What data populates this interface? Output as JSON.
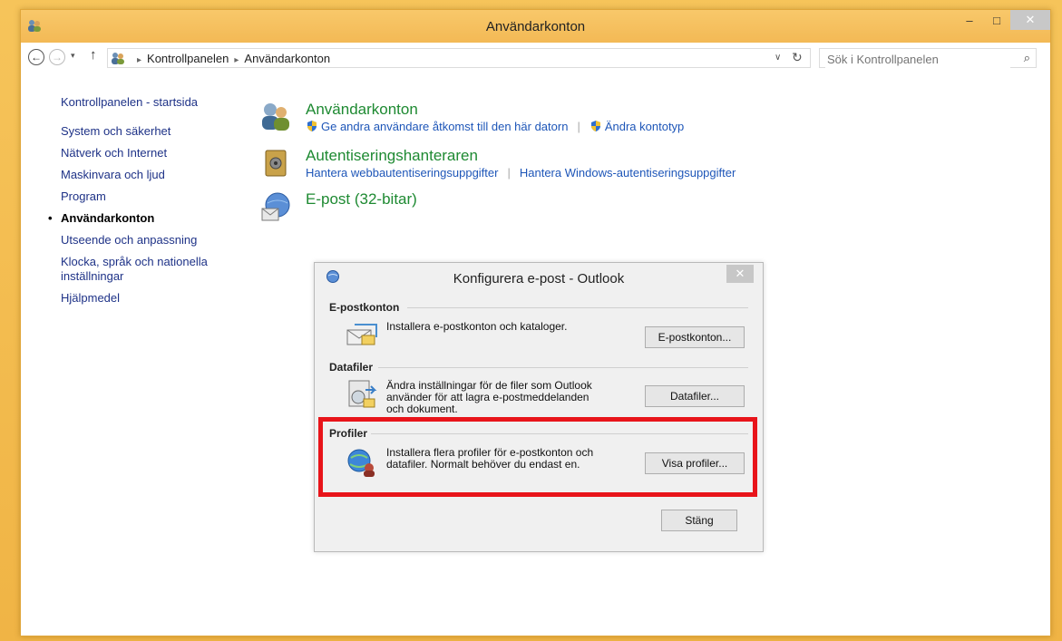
{
  "window": {
    "title": "Användarkonton",
    "minimize": "‒",
    "maximize": "□",
    "close": "✕"
  },
  "nav": {
    "back": "←",
    "forward": "→",
    "dropdown": "▾",
    "up": "↑",
    "breadcrumbs": [
      "Kontrollpanelen",
      "Användarkonton"
    ],
    "crumb_sep": "▸",
    "addr_dropdown": "∨",
    "refresh": "↻",
    "search_placeholder": "Sök i Kontrollpanelen",
    "search_icon": "⌕"
  },
  "sidebar": {
    "items": [
      "Kontrollpanelen - startsida",
      "System och säkerhet",
      "Nätverk och Internet",
      "Maskinvara och ljud",
      "Program",
      "Användarkonton",
      "Utseende och anpassning",
      "Klocka, språk och nationella inställningar",
      "Hjälpmedel"
    ],
    "active_index": 5,
    "bullet": "•"
  },
  "categories": [
    {
      "title": "Användarkonton",
      "icon": "users-icon",
      "links": [
        "Ge andra användare åtkomst till den här datorn",
        "Ändra kontotyp"
      ]
    },
    {
      "title": "Autentiseringshanteraren",
      "icon": "credential-vault-icon",
      "links": [
        "Hantera webbautentiseringsuppgifter",
        "Hantera Windows-autentiseringsuppgifter"
      ]
    },
    {
      "title": "E-post (32-bitar)",
      "icon": "mail-globe-icon",
      "links": []
    }
  ],
  "dialog": {
    "title": "Konfigurera e-post - Outlook",
    "close": "✕",
    "groups": [
      {
        "label": "E-postkonton",
        "desc": "Installera e-postkonton och kataloger.",
        "button": "E-postkonton..."
      },
      {
        "label": "Datafiler",
        "desc_lines": [
          "Ändra inställningar för de filer som Outlook",
          "använder för att lagra e-postmeddelanden",
          "och dokument."
        ],
        "button": "Datafiler..."
      },
      {
        "label": "Profiler",
        "desc_lines": [
          "Installera flera profiler för e-postkonton och",
          "datafiler. Normalt behöver du endast en."
        ],
        "button": "Visa profiler..."
      }
    ],
    "close_button": "Stäng"
  },
  "colors": {
    "titlebar": "#f3b955",
    "link": "#1e56b8",
    "category_title": "#1e8a32",
    "sidebar_link": "#1e3287",
    "highlight": "#e8141a"
  }
}
